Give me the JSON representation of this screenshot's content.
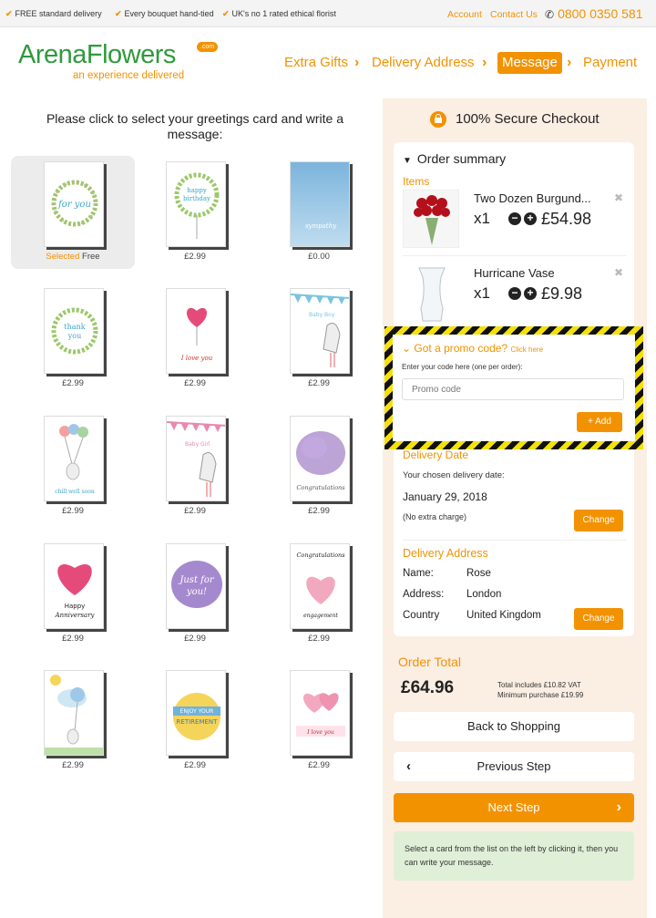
{
  "topbar": {
    "usps": [
      "FREE standard delivery",
      "Every bouquet hand-tied",
      "UK's no 1 rated ethical florist"
    ],
    "account": "Account",
    "contact": "Contact Us",
    "phone": "0800 0350 581"
  },
  "header": {
    "logo": "ArenaFlowers",
    "logo_badge": ".com",
    "tagline": "an experience delivered",
    "steps": [
      "Extra Gifts",
      "Delivery Address",
      "Message",
      "Payment"
    ],
    "active_step": "Message"
  },
  "left": {
    "title": "Please click to select your greetings card and write a message:",
    "selected_label": "Selected",
    "cards": [
      {
        "name": "for you",
        "price": "Free",
        "selected": true
      },
      {
        "name": "happy birthday",
        "price": "£2.99"
      },
      {
        "name": "sympathy",
        "price": "£0.00"
      },
      {
        "name": "thank you",
        "price": "£2.99"
      },
      {
        "name": "I love you",
        "price": "£2.99"
      },
      {
        "name": "Baby Boy",
        "price": "£2.99"
      },
      {
        "name": "balloons bunny",
        "price": "£2.99"
      },
      {
        "name": "Baby Girl",
        "price": "£2.99"
      },
      {
        "name": "Congratulations",
        "price": "£2.99"
      },
      {
        "name": "Happy Anniversary",
        "price": "£2.99"
      },
      {
        "name": "Just for you!",
        "price": "£2.99"
      },
      {
        "name": "Congratulations engagement",
        "price": "£2.99"
      },
      {
        "name": "bunny balloon",
        "price": "£2.99"
      },
      {
        "name": "Enjoy your Retirement",
        "price": "£2.99"
      },
      {
        "name": "I love you hearts",
        "price": "£2.99"
      }
    ]
  },
  "right": {
    "secure": "100% Secure Checkout",
    "order_summary": "Order summary",
    "items_label": "Items",
    "items": [
      {
        "name": "Two Dozen Burgund...",
        "qty": "x1",
        "price": "£54.98"
      },
      {
        "name": "Hurricane Vase",
        "qty": "x1",
        "price": "£9.98"
      }
    ],
    "promo": {
      "title": "Got a promo code?",
      "click": "Click here",
      "hint": "Enter your code here (one per order):",
      "placeholder": "Promo code",
      "add": "+ Add"
    },
    "delivery_date": {
      "title": "Delivery Date",
      "subtitle": "Your chosen delivery date:",
      "date": "January 29, 2018",
      "note": "(No extra charge)",
      "change": "Change"
    },
    "delivery_address": {
      "title": "Delivery Address",
      "name_label": "Name:",
      "name": "Rose",
      "address_label": "Address:",
      "address": "London",
      "country_label": "Country",
      "country": "United Kingdom",
      "change": "Change"
    },
    "order_total": {
      "title": "Order Total",
      "amount": "£64.96",
      "vat": "Total includes £10.82 VAT",
      "minimum": "Minimum purchase £19.99"
    },
    "back_to_shopping": "Back to Shopping",
    "previous_step": "Previous Step",
    "next_step": "Next Step",
    "info": "Select a card from the list on the left by clicking it, then you can write your message."
  },
  "colors": {
    "accent": "#f39200",
    "brand_green": "#2f9a3b",
    "panel_bg": "#fbeee3",
    "info_bg": "#e0f0d8"
  }
}
